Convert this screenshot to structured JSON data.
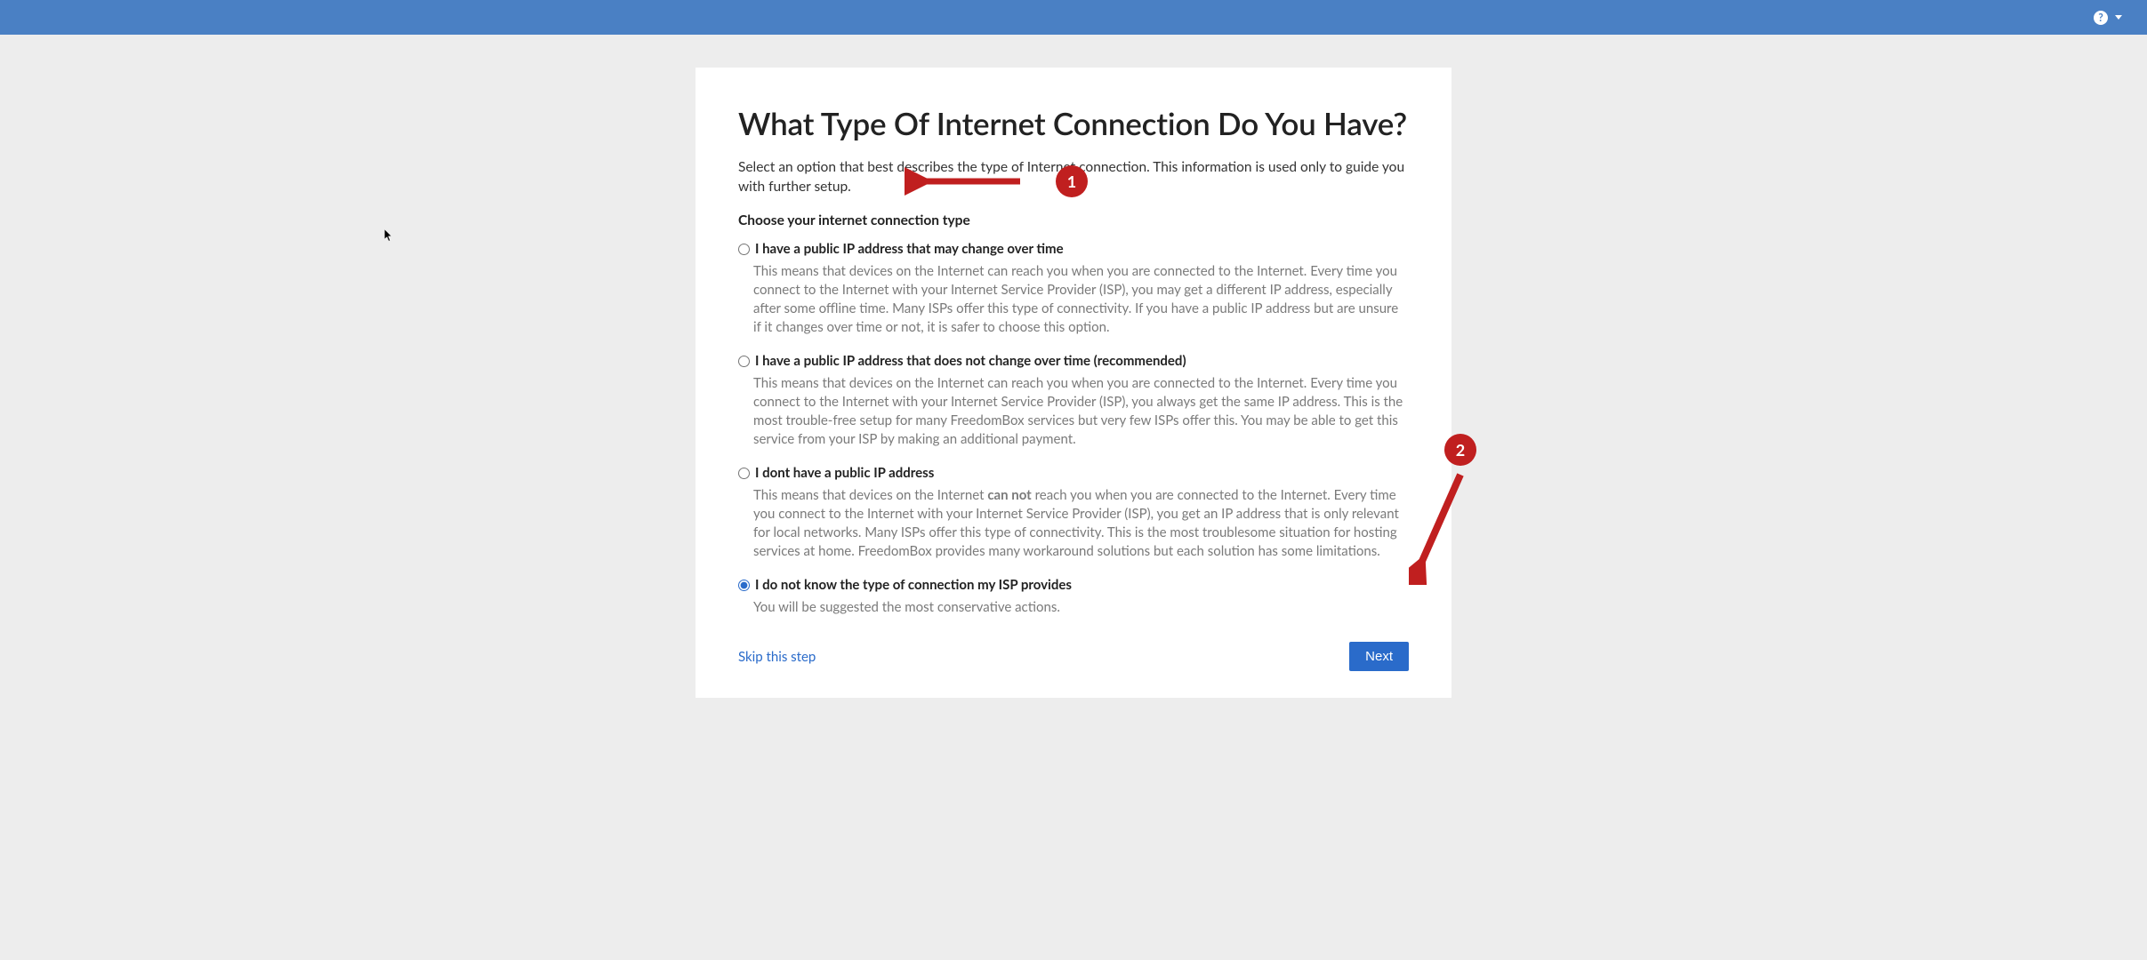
{
  "header": {
    "help_tooltip": "Help"
  },
  "page": {
    "title": "What Type Of Internet Connection Do You Have?",
    "subtitle": "Select an option that best describes the type of Internet connection. This information is used only to guide you with further setup.",
    "section_label": "Choose your internet connection type",
    "options": [
      {
        "id": "dynamic-public-ip",
        "label": "I have a public IP address that may change over time",
        "description": "This means that devices on the Internet can reach you when you are connected to the Internet. Every time you connect to the Internet with your Internet Service Provider (ISP), you may get a different IP address, especially after some offline time. Many ISPs offer this type of connectivity. If you have a public IP address but are unsure if it changes over time or not, it is safer to choose this option.",
        "selected": false
      },
      {
        "id": "static-public-ip",
        "label": "I have a public IP address that does not change over time (recommended)",
        "description": "This means that devices on the Internet can reach you when you are connected to the Internet. Every time you connect to the Internet with your Internet Service Provider (ISP), you always get the same IP address. This is the most trouble-free setup for many FreedomBox services but very few ISPs offer this. You may be able to get this service from your ISP by making an additional payment.",
        "selected": false
      },
      {
        "id": "no-public-ip",
        "label": "I dont have a public IP address",
        "desc_pre": "This means that devices on the Internet ",
        "desc_bold": "can not",
        "desc_post": " reach you when you are connected to the Internet. Every time you connect to the Internet with your Internet Service Provider (ISP), you get an IP address that is only relevant for local networks. Many ISPs offer this type of connectivity. This is the most troublesome situation for hosting services at home. FreedomBox provides many workaround solutions but each solution has some limitations.",
        "selected": false
      },
      {
        "id": "unknown",
        "label": "I do not know the type of connection my ISP provides",
        "description": "You will be suggested the most conservative actions.",
        "selected": true
      }
    ],
    "skip_label": "Skip this step",
    "next_label": "Next"
  },
  "annotations": {
    "badge1": "1",
    "badge2": "2"
  },
  "colors": {
    "topbar": "#4a80c4",
    "primary_button": "#2a6bca",
    "annotation": "#c01f1f",
    "body_bg": "#ededed"
  }
}
